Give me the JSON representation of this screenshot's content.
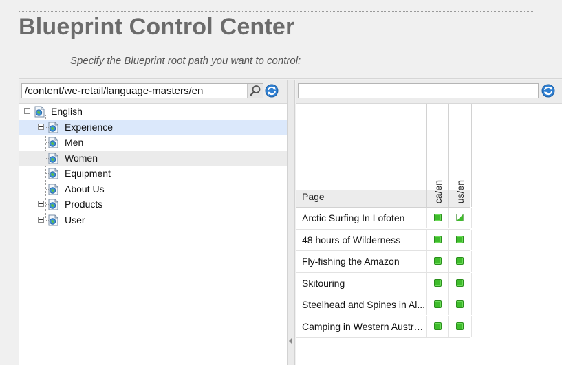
{
  "header": {
    "title": "Blueprint Control Center",
    "subtitle": "Specify the Blueprint root path you want to control:"
  },
  "path_field": {
    "value": "/content/we-retail/language-masters/en"
  },
  "filter_field": {
    "value": ""
  },
  "tree": {
    "root": {
      "label": "English",
      "state": "expanded"
    },
    "children": [
      {
        "label": "Experience",
        "state": "collapsed",
        "selected": true
      },
      {
        "label": "Men",
        "state": "leaf"
      },
      {
        "label": "Women",
        "state": "leaf",
        "hover": true
      },
      {
        "label": "Equipment",
        "state": "leaf"
      },
      {
        "label": "About Us",
        "state": "leaf"
      },
      {
        "label": "Products",
        "state": "collapsed"
      },
      {
        "label": "User",
        "state": "collapsed"
      }
    ]
  },
  "grid": {
    "page_header": "Page",
    "columns": [
      "ca/en",
      "us/en"
    ],
    "rows": [
      {
        "name": "Arctic Surfing In Lofoten",
        "status": [
          "synced",
          "partial"
        ]
      },
      {
        "name": "48 hours of Wilderness",
        "status": [
          "synced",
          "synced"
        ]
      },
      {
        "name": "Fly-fishing the Amazon",
        "status": [
          "synced",
          "synced"
        ]
      },
      {
        "name": "Skitouring",
        "status": [
          "synced",
          "synced"
        ]
      },
      {
        "name": "Steelhead and Spines in Al...",
        "status": [
          "synced",
          "synced"
        ]
      },
      {
        "name": "Camping in Western Austra...",
        "status": [
          "synced",
          "synced"
        ]
      }
    ]
  },
  "icons": {
    "search": "magnifier-icon",
    "refresh": "refresh-icon",
    "page": "page-icon",
    "expand": "plus-toggle-icon",
    "collapse": "minus-toggle-icon"
  },
  "colors": {
    "selected_row": "#dbe8fb",
    "status_green": "#3fbc2c",
    "title_gray": "#6b6b6b"
  }
}
